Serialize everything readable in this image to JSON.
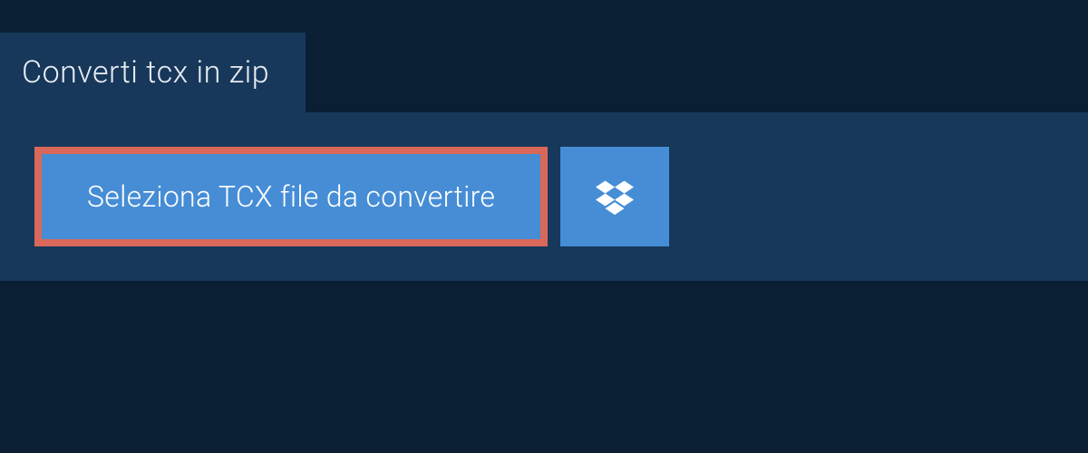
{
  "tab": {
    "label": "Converti tcx in zip"
  },
  "actions": {
    "select_file_label": "Seleziona TCX file da convertire"
  }
}
